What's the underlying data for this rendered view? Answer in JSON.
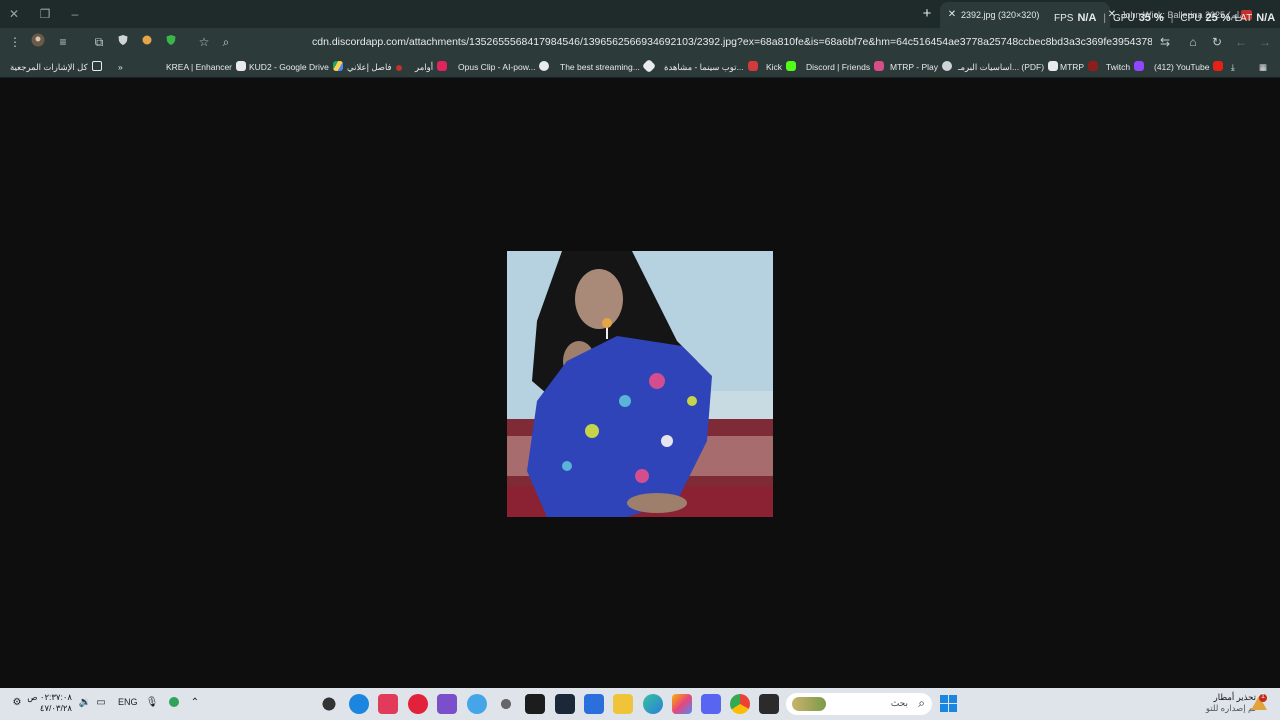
{
  "window": {
    "new_tab": "+",
    "tabs": [
      {
        "title": "2392.jpg (320×320)",
        "active": true
      },
      {
        "title": "John Wick: Ballerina 2025 (فيلم",
        "active": false
      }
    ]
  },
  "overlay": {
    "fps_label": "FPS",
    "fps_value": "N/A",
    "gpu_label": "GPU",
    "gpu_value": "35 %",
    "cpu_label": "CPU",
    "cpu_value": "25 %",
    "lat_label": "LAT",
    "lat_value": "N/A"
  },
  "toolbar": {
    "url": "cdn.discordapp.com/attachments/1352655568417984546/1396562566934692103/2392.jpg?ex=68a810fe&is=68a6bf7e&hm=64c516454ae3778a25748ccbec8bd3a3c369fe39543787dc60260481cc53270f&"
  },
  "bookmarks": {
    "all_bookmarks": "كل الإشارات المرجعية",
    "more": "»",
    "items": [
      {
        "label": "KREA | Enhancer"
      },
      {
        "label": "KUD2 - Google Drive"
      },
      {
        "label": "فاصل إعلاني"
      },
      {
        "label": "أوامر"
      },
      {
        "label": "Opus Clip - AI-pow..."
      },
      {
        "label": "The best streaming..."
      },
      {
        "label": "توب سينما - مشاهدة..."
      },
      {
        "label": "Kick"
      },
      {
        "label": "Discord | Friends"
      },
      {
        "label": "MTRP - Play"
      },
      {
        "label": "اساسيات البرمـ... (PDF)"
      },
      {
        "label": "MTRP"
      },
      {
        "label": "Twitch"
      },
      {
        "label": "(412) YouTube"
      }
    ]
  },
  "taskbar": {
    "time": "٠٢:٣٧:٠٨ ص",
    "date": "٤٧/٠٣/٢٨",
    "lang": "ENG",
    "search_placeholder": "بحث",
    "weather_title": "تحذير أمطار",
    "weather_sub": "تم إصداره للتو",
    "weather_badge": "1"
  }
}
